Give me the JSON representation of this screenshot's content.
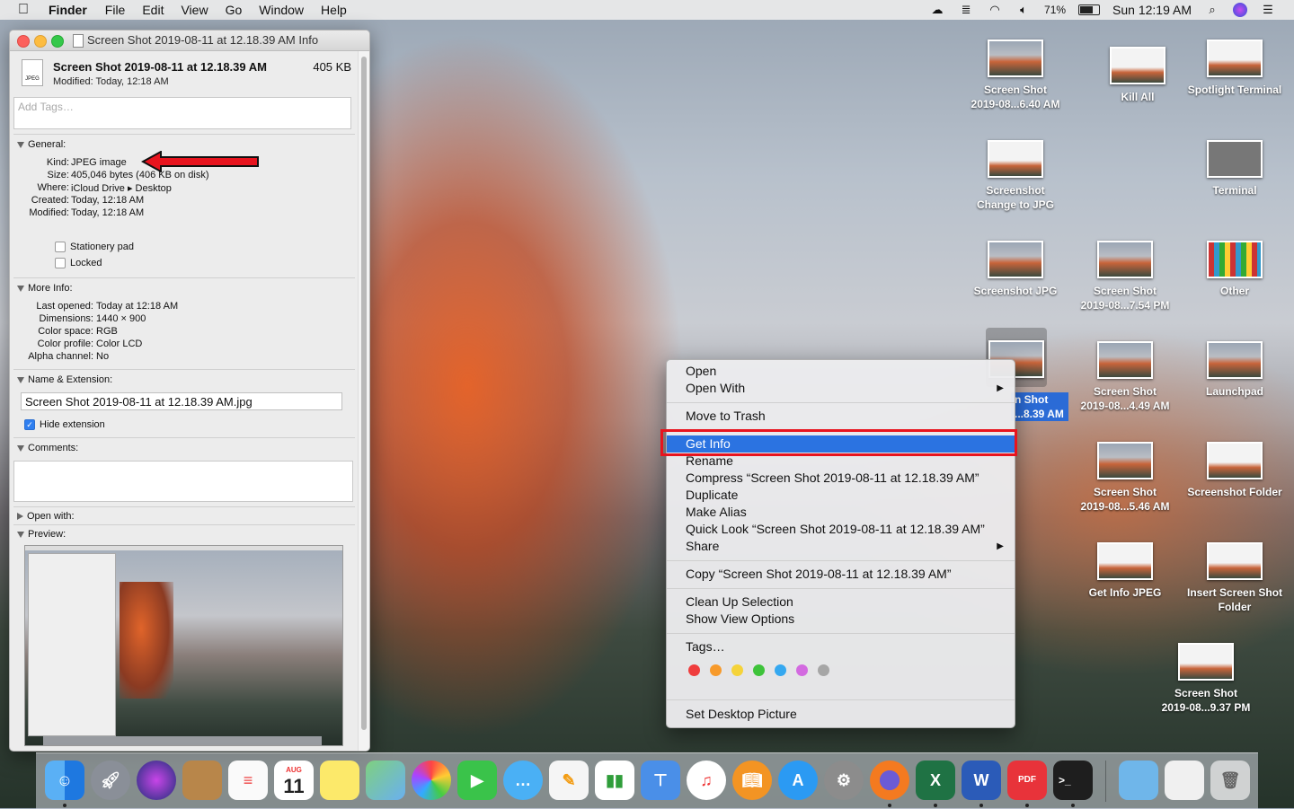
{
  "menubar": {
    "app_name": "Finder",
    "items": [
      "File",
      "Edit",
      "View",
      "Go",
      "Window",
      "Help"
    ],
    "battery": "71%",
    "clock": "Sun 12:19 AM"
  },
  "info_window": {
    "title": "Screen Shot 2019-08-11 at 12.18.39 AM Info",
    "file_icon_label": "JPEG",
    "file_name": "Screen Shot 2019-08-11 at 12.18.39 AM",
    "file_size": "405 KB",
    "modified_line": "Modified: Today, 12:18 AM",
    "tags_placeholder": "Add Tags…",
    "general": {
      "header": "General:",
      "rows": [
        {
          "k": "Kind:",
          "v": "JPEG image"
        },
        {
          "k": "Size:",
          "v": "405,046 bytes (406 KB on disk)"
        },
        {
          "k": "Where:",
          "v": "iCloud Drive ▸ Desktop"
        },
        {
          "k": "Created:",
          "v": "Today, 12:18 AM"
        },
        {
          "k": "Modified:",
          "v": "Today, 12:18 AM"
        }
      ],
      "stationery": "Stationery pad",
      "locked": "Locked"
    },
    "more_info": {
      "header": "More Info:",
      "rows": [
        {
          "k": "Last opened:",
          "v": "Today at 12:18 AM"
        },
        {
          "k": "Dimensions:",
          "v": "1440 × 900"
        },
        {
          "k": "Color space:",
          "v": "RGB"
        },
        {
          "k": "Color profile:",
          "v": "Color LCD"
        },
        {
          "k": "Alpha channel:",
          "v": "No"
        }
      ]
    },
    "name_ext": {
      "header": "Name & Extension:",
      "value": "Screen Shot 2019-08-11 at 12.18.39 AM.jpg",
      "hide_extension": "Hide extension"
    },
    "comments_header": "Comments:",
    "open_with_header": "Open with:",
    "preview_header": "Preview:"
  },
  "context_menu": {
    "open": "Open",
    "open_with": "Open With",
    "move_to_trash": "Move to Trash",
    "get_info": "Get Info",
    "rename": "Rename",
    "compress": "Compress “Screen Shot 2019-08-11 at 12.18.39 AM”",
    "duplicate": "Duplicate",
    "make_alias": "Make Alias",
    "quick_look": "Quick Look “Screen Shot 2019-08-11 at 12.18.39 AM”",
    "share": "Share",
    "copy": "Copy “Screen Shot 2019-08-11 at 12.18.39 AM”",
    "clean_up": "Clean Up Selection",
    "show_view_options": "Show View Options",
    "tags": "Tags…",
    "tag_colors": [
      "#ef3d3d",
      "#f79a2b",
      "#f5d33a",
      "#3ec33a",
      "#35a8f0",
      "#d36ae0",
      "#a6a6a6"
    ],
    "set_desktop_picture": "Set Desktop Picture"
  },
  "desktop_icons": {
    "i1": [
      "Screen Shot",
      "2019-08...6.40 AM"
    ],
    "i2": [
      "Kill All"
    ],
    "i3": [
      "Spotlight Terminal"
    ],
    "i4": [
      "Screenshot",
      "Change to JPG"
    ],
    "i5": [
      "Terminal"
    ],
    "i6": [
      "Screenshot JPG"
    ],
    "i7": [
      "Screen Shot",
      "2019-08...7.54 PM"
    ],
    "i8": [
      "Other"
    ],
    "sel": [
      "n Shot",
      "...8.39 AM"
    ],
    "i9": [
      "Screen Shot",
      "2019-08...4.49 AM"
    ],
    "i10": [
      "Launchpad"
    ],
    "i11": [
      "Screen Shot",
      "2019-08...5.46 AM"
    ],
    "i12": [
      "Screenshot Folder"
    ],
    "i13": [
      "Get Info JPEG"
    ],
    "i14": [
      "Insert Screen Shot",
      "Folder"
    ],
    "i15": [
      "Screen Shot",
      "2019-08...9.37 PM"
    ]
  },
  "dock": {
    "calendar_month": "AUG",
    "calendar_day": "11",
    "pdf_label": "PDF"
  }
}
